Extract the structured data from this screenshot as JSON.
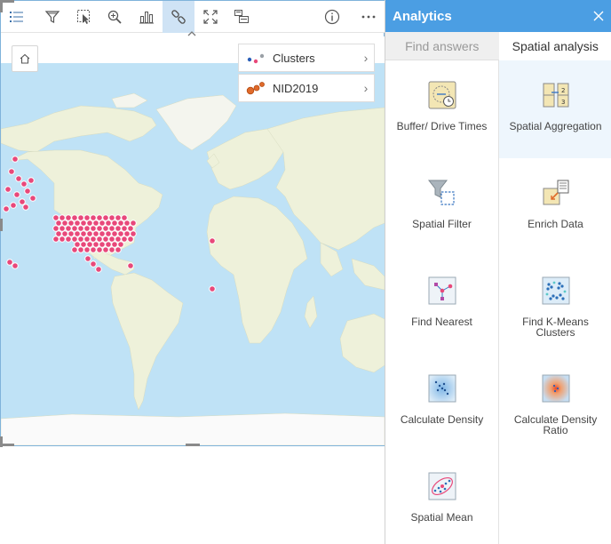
{
  "toolbar": {
    "items": [
      "layers-list",
      "filter",
      "selection",
      "zoom",
      "chart",
      "link",
      "maximize",
      "flip-card",
      "info",
      "more"
    ],
    "active": "link"
  },
  "map": {
    "colors": {
      "ocean": "#bfe2f6",
      "land": "#eef1da",
      "ice": "#fafafa",
      "points": "#e8487a"
    }
  },
  "legend": [
    {
      "label": "Clusters",
      "icon": "clusters-icon"
    },
    {
      "label": "NID2019",
      "icon": "nid2019-icon"
    }
  ],
  "panel": {
    "title": "Analytics",
    "header_color": "#4b9ee3",
    "tabs": [
      {
        "label": "Find answers",
        "active": false
      },
      {
        "label": "Spatial analysis",
        "active": true
      }
    ],
    "tools": [
      {
        "label": "Buffer/ Drive Times",
        "icon": "buffer-drive-times-icon",
        "selected": false
      },
      {
        "label": "Spatial Aggregation",
        "icon": "spatial-aggregation-icon",
        "selected": true
      },
      {
        "label": "Spatial Filter",
        "icon": "spatial-filter-icon",
        "selected": false
      },
      {
        "label": "Enrich Data",
        "icon": "enrich-data-icon",
        "selected": false
      },
      {
        "label": "Find Nearest",
        "icon": "find-nearest-icon",
        "selected": false
      },
      {
        "label": "Find K-Means Clusters",
        "icon": "k-means-clusters-icon",
        "selected": false
      },
      {
        "label": "Calculate Density",
        "icon": "calculate-density-icon",
        "selected": false
      },
      {
        "label": "Calculate Density Ratio",
        "icon": "density-ratio-icon",
        "selected": false
      },
      {
        "label": "Spatial Mean",
        "icon": "spatial-mean-icon",
        "selected": false
      }
    ]
  }
}
